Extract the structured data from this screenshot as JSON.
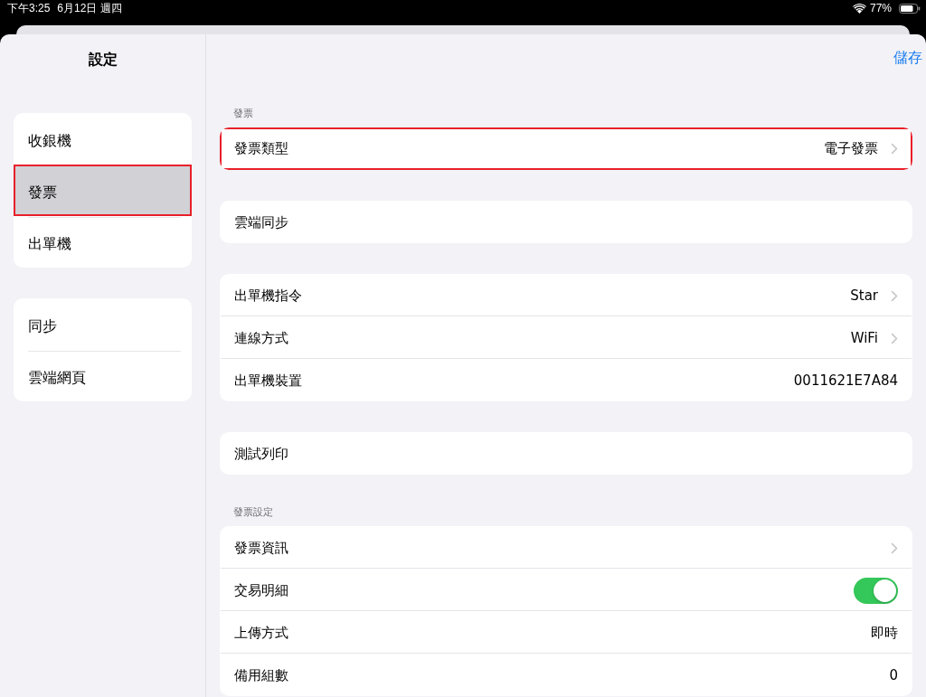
{
  "status_bar": {
    "time": "下午3:25",
    "date": "6月12日 週四",
    "battery": "77%"
  },
  "sidebar": {
    "title": "設定",
    "groups": [
      {
        "items": [
          {
            "label": "收銀機",
            "selected": false,
            "highlighted": false
          },
          {
            "label": "發票",
            "selected": true,
            "highlighted": true
          },
          {
            "label": "出單機",
            "selected": false,
            "highlighted": false
          }
        ]
      },
      {
        "items": [
          {
            "label": "同步",
            "selected": false,
            "highlighted": false
          },
          {
            "label": "雲端網頁",
            "selected": false,
            "highlighted": false
          }
        ]
      }
    ]
  },
  "detail": {
    "save_button": "儲存",
    "groups": [
      {
        "header": "發票",
        "rows": [
          {
            "kind": "link",
            "label": "發票類型",
            "value": "電子發票",
            "highlighted": true
          }
        ]
      },
      {
        "rows": [
          {
            "kind": "plain",
            "label": "雲端同步",
            "highlighted": false
          }
        ]
      },
      {
        "rows": [
          {
            "kind": "link",
            "label": "出單機指令",
            "value": "Star",
            "highlighted": false
          },
          {
            "kind": "link",
            "label": "連線方式",
            "value": "WiFi",
            "highlighted": false
          },
          {
            "kind": "value",
            "label": "出單機裝置",
            "value": "0011621E7A84",
            "highlighted": false
          }
        ]
      },
      {
        "rows": [
          {
            "kind": "plain",
            "label": "測試列印",
            "highlighted": false
          }
        ]
      },
      {
        "header": "發票設定",
        "rows": [
          {
            "kind": "link",
            "label": "發票資訊",
            "highlighted": false
          },
          {
            "kind": "toggle",
            "label": "交易明細",
            "on": true,
            "highlighted": false
          },
          {
            "kind": "value",
            "label": "上傳方式",
            "value": "即時",
            "highlighted": false
          },
          {
            "kind": "value",
            "label": "備用組數",
            "value": "0",
            "highlighted": false
          }
        ]
      }
    ]
  }
}
